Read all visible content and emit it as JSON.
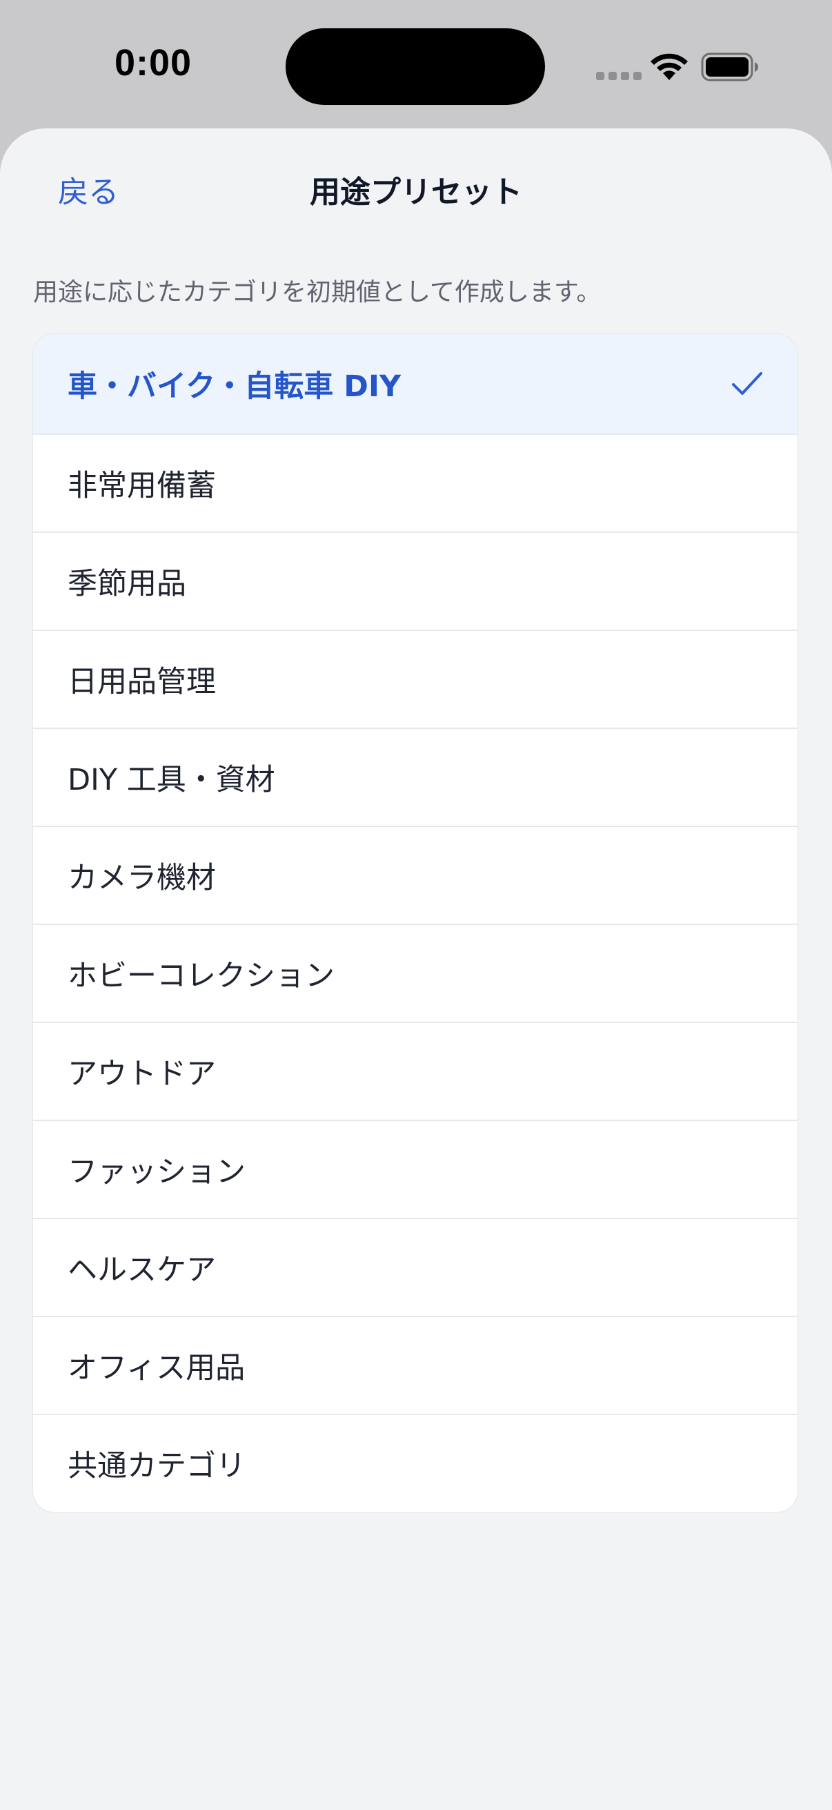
{
  "status_bar": {
    "time": "0:00"
  },
  "nav": {
    "back_label": "戻る",
    "title": "用途プリセット"
  },
  "description": "用途に応じたカテゴリを初期値として作成します。",
  "presets": [
    {
      "label": "車・バイク・自転車 DIY",
      "selected": true
    },
    {
      "label": "非常用備蓄",
      "selected": false
    },
    {
      "label": "季節用品",
      "selected": false
    },
    {
      "label": "日用品管理",
      "selected": false
    },
    {
      "label": "DIY 工具・資材",
      "selected": false
    },
    {
      "label": "カメラ機材",
      "selected": false
    },
    {
      "label": "ホビーコレクション",
      "selected": false
    },
    {
      "label": "アウトドア",
      "selected": false
    },
    {
      "label": "ファッション",
      "selected": false
    },
    {
      "label": "ヘルスケア",
      "selected": false
    },
    {
      "label": "オフィス用品",
      "selected": false
    },
    {
      "label": "共通カテゴリ",
      "selected": false
    }
  ],
  "icons": {
    "selected_indicator": "checkmark-icon",
    "wifi": "wifi-icon",
    "battery": "battery-icon"
  },
  "colors": {
    "accent": "#2f5fd0",
    "selected_row_bg": "#eef4fe",
    "sheet_bg": "#f2f3f5"
  }
}
